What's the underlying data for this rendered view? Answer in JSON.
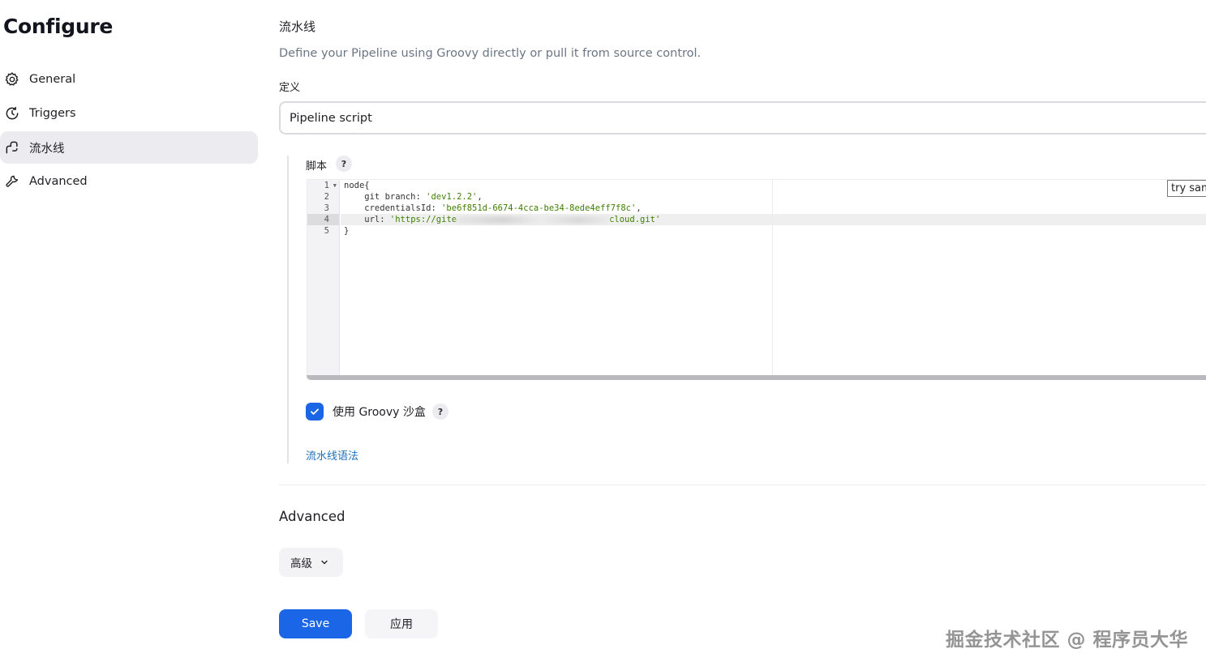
{
  "page": {
    "title": "Configure"
  },
  "sidebar": {
    "items": [
      {
        "label": "General",
        "icon": "gear-icon",
        "active": false
      },
      {
        "label": "Triggers",
        "icon": "clock-icon",
        "active": false
      },
      {
        "label": "流水线",
        "icon": "pipeline-icon",
        "active": true
      },
      {
        "label": "Advanced",
        "icon": "wrench-icon",
        "active": false
      }
    ]
  },
  "pipeline": {
    "title": "流水线",
    "description": "Define your Pipeline using Groovy directly or pull it from source control.",
    "definition_label": "定义",
    "definition_value": "Pipeline script",
    "script_label": "脚本",
    "help_glyph": "?",
    "try_sample_label": "try samp",
    "code": {
      "line_numbers": [
        "1",
        "2",
        "3",
        "4",
        "5"
      ],
      "line1": "node{",
      "line2_key": "    git branch: ",
      "line2_str": "'dev1.2.2'",
      "line2_tail": ",",
      "line3_key": "    credentialsId: ",
      "line3_str": "'be6f851d-6674-4cca-be34-8ede4eff7f8c'",
      "line3_tail": ",",
      "line4_key": "    url: ",
      "line4_str_start": "'https://gite",
      "line4_str_end": "cloud.git'",
      "line5": "}"
    },
    "sandbox_label": "使用 Groovy 沙盒",
    "sandbox_checked": true,
    "syntax_link": "流水线语法"
  },
  "advanced": {
    "title": "Advanced",
    "button_label": "高级"
  },
  "actions": {
    "save_label": "Save",
    "apply_label": "应用"
  },
  "watermark": "掘金技术社区 @ 程序员大华",
  "colors": {
    "accent": "#1a66e6",
    "link": "#1f6fb8",
    "active_nav_bg": "#ebebf0",
    "code_string": "#3f7f00"
  }
}
